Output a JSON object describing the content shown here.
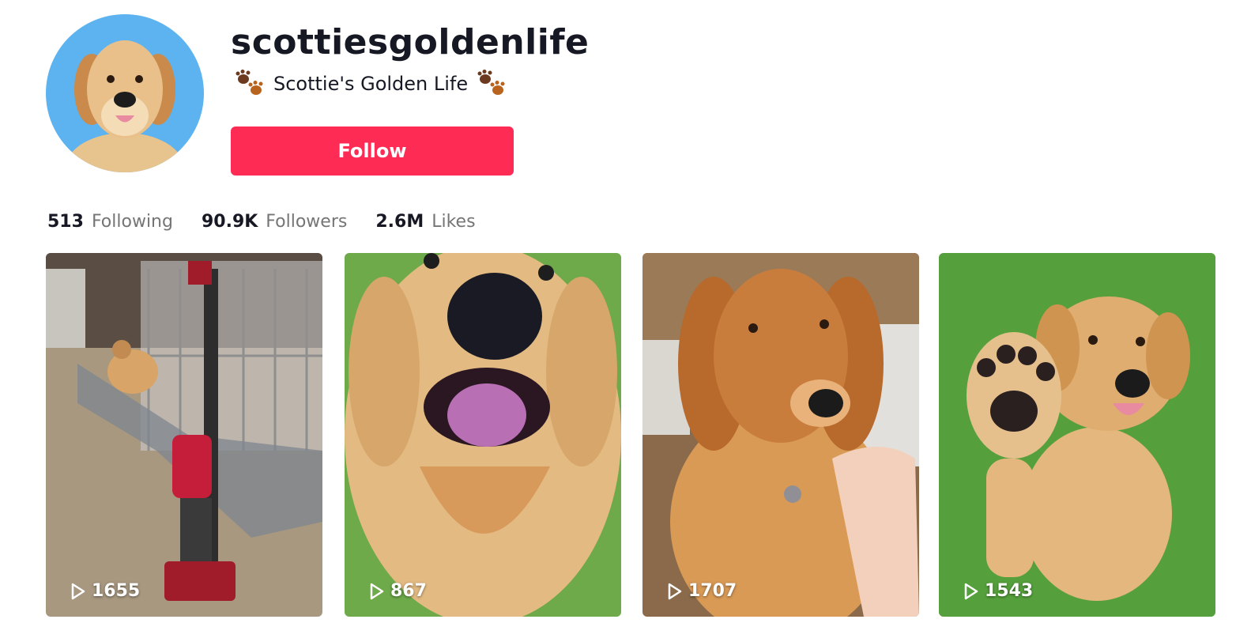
{
  "profile": {
    "username": "scottiesgoldenlife",
    "nickname": "Scottie's Golden Life",
    "follow_label": "Follow",
    "avatar_bg": "#5db3f0"
  },
  "stats": [
    {
      "value": "513",
      "label": "Following"
    },
    {
      "value": "90.9K",
      "label": "Followers"
    },
    {
      "value": "2.6M",
      "label": "Likes"
    }
  ],
  "videos": [
    {
      "views": "1655",
      "icon": "play-icon"
    },
    {
      "views": "867",
      "icon": "play-icon"
    },
    {
      "views": "1707",
      "icon": "play-icon"
    },
    {
      "views": "1543",
      "icon": "play-icon"
    }
  ],
  "colors": {
    "follow_button": "#fe2c55",
    "text_primary": "#161823",
    "text_secondary": "#757575"
  }
}
